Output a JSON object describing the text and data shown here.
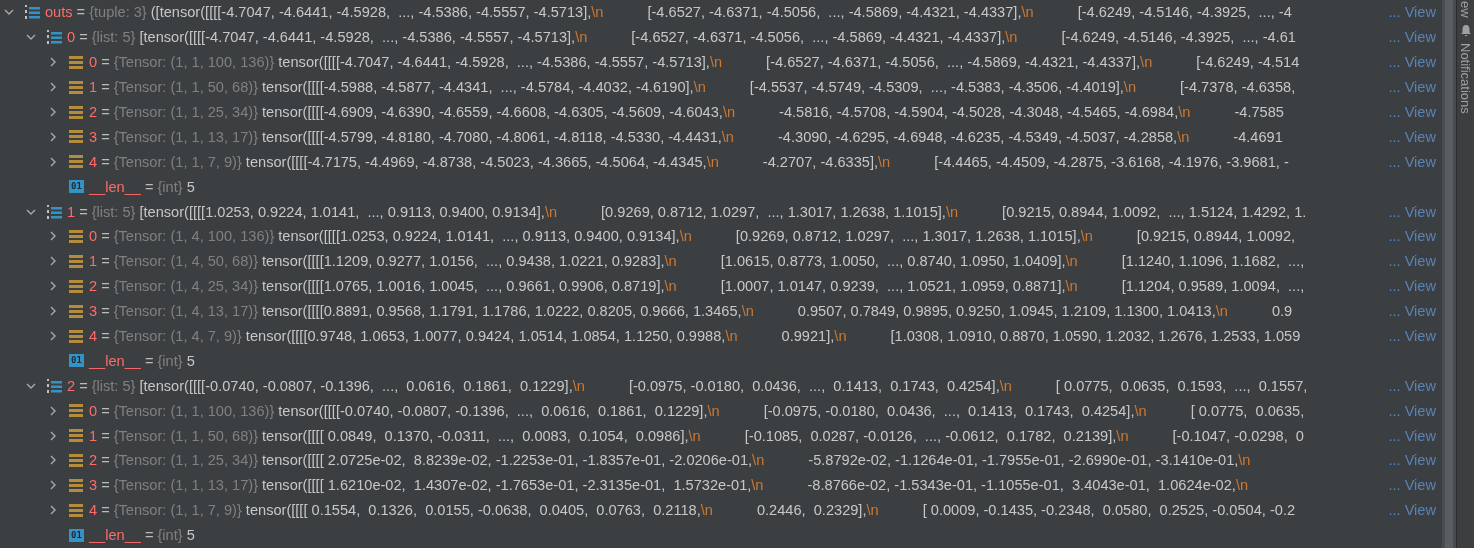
{
  "tree": [
    {
      "kind": "tuple",
      "name": "outs",
      "eq": "=",
      "type": "{tuple: 3}",
      "expanded": true,
      "parts": [
        {
          "kind": "text",
          "t": "([tensor([[[[-4.7047, -4.6441, -4.5928,  ..., -4.5386, -4.5557, -4.5713],"
        },
        {
          "kind": "nl",
          "t": "\\n"
        },
        {
          "kind": "text",
          "t": "[-4.6527, -4.6371, -4.5056,  ..., -4.5869, -4.4321, -4.4337],"
        },
        {
          "kind": "nl",
          "t": "\\n"
        },
        {
          "kind": "text",
          "t": "[-4.6249, -4.5146, -4.3925,  ..., -4"
        }
      ],
      "more": "...",
      "link": "View",
      "children": [
        {
          "kind": "list",
          "name": "0",
          "eq": "=",
          "type": "{list: 5}",
          "expanded": true,
          "parts": [
            {
              "kind": "text",
              "t": "[tensor([[[[-4.7047, -4.6441, -4.5928,  ..., -4.5386, -4.5557, -4.5713],"
            },
            {
              "kind": "nl",
              "t": "\\n"
            },
            {
              "kind": "text",
              "t": "[-4.6527, -4.6371, -4.5056,  ..., -4.5869, -4.4321, -4.4337],"
            },
            {
              "kind": "nl",
              "t": "\\n"
            },
            {
              "kind": "text",
              "t": "[-4.6249, -4.5146, -4.3925,  ..., -4.61"
            }
          ],
          "more": "...",
          "link": "View",
          "children": [
            {
              "kind": "tensor",
              "name": "0",
              "eq": "=",
              "type": "{Tensor: (1, 1, 100, 136)}",
              "expanded": false,
              "parts": [
                {
                  "kind": "text",
                  "t": "tensor([[[[-4.7047, -4.6441, -4.5928,  ..., -4.5386, -4.5557, -4.5713],"
                },
                {
                  "kind": "nl",
                  "t": "\\n"
                },
                {
                  "kind": "text",
                  "t": "[-4.6527, -4.6371, -4.5056,  ..., -4.5869, -4.4321, -4.4337],"
                },
                {
                  "kind": "nl",
                  "t": "\\n"
                },
                {
                  "kind": "text",
                  "t": "[-4.6249, -4.514"
                }
              ],
              "more": "...",
              "link": "View"
            },
            {
              "kind": "tensor",
              "name": "1",
              "eq": "=",
              "type": "{Tensor: (1, 1, 50, 68)}",
              "expanded": false,
              "parts": [
                {
                  "kind": "text",
                  "t": "tensor([[[[-4.5988, -4.5877, -4.4341,  ..., -4.5784, -4.4032, -4.6190],"
                },
                {
                  "kind": "nl",
                  "t": "\\n"
                },
                {
                  "kind": "text",
                  "t": "[-4.5537, -4.5749, -4.5309,  ..., -4.5383, -4.3506, -4.4019],"
                },
                {
                  "kind": "nl",
                  "t": "\\n"
                },
                {
                  "kind": "text",
                  "t": "[-4.7378, -4.6358,"
                }
              ],
              "more": "...",
              "link": "View"
            },
            {
              "kind": "tensor",
              "name": "2",
              "eq": "=",
              "type": "{Tensor: (1, 1, 25, 34)}",
              "expanded": false,
              "parts": [
                {
                  "kind": "text",
                  "t": "tensor([[[[-4.6909, -4.6390, -4.6559, -4.6608, -4.6305, -4.5609, -4.6043,"
                },
                {
                  "kind": "nl",
                  "t": "\\n"
                },
                {
                  "kind": "text",
                  "t": "-4.5816, -4.5708, -4.5904, -4.5028, -4.3048, -4.5465, -4.6984,"
                },
                {
                  "kind": "nl",
                  "t": "\\n"
                },
                {
                  "kind": "text",
                  "t": "-4.7585"
                }
              ],
              "more": "...",
              "link": "View"
            },
            {
              "kind": "tensor",
              "name": "3",
              "eq": "=",
              "type": "{Tensor: (1, 1, 13, 17)}",
              "expanded": false,
              "parts": [
                {
                  "kind": "text",
                  "t": "tensor([[[[-4.5799, -4.8180, -4.7080, -4.8061, -4.8118, -4.5330, -4.4431,"
                },
                {
                  "kind": "nl",
                  "t": "\\n"
                },
                {
                  "kind": "text",
                  "t": "-4.3090, -4.6295, -4.6948, -4.6235, -4.5349, -4.5037, -4.2858,"
                },
                {
                  "kind": "nl",
                  "t": "\\n"
                },
                {
                  "kind": "text",
                  "t": "-4.4691"
                }
              ],
              "more": "...",
              "link": "View"
            },
            {
              "kind": "tensor",
              "name": "4",
              "eq": "=",
              "type": "{Tensor: (1, 1, 7, 9)}",
              "expanded": false,
              "parts": [
                {
                  "kind": "text",
                  "t": "tensor([[[[-4.7175, -4.4969, -4.8738, -4.5023, -4.3665, -4.5064, -4.4345,"
                },
                {
                  "kind": "nl",
                  "t": "\\n"
                },
                {
                  "kind": "text",
                  "t": "-4.2707, -4.6335],"
                },
                {
                  "kind": "nl",
                  "t": "\\n"
                },
                {
                  "kind": "text",
                  "t": "[-4.4465, -4.4509, -4.2875, -3.6168, -4.1976, -3.9681, -"
                }
              ],
              "more": "...",
              "link": "View"
            },
            {
              "kind": "int",
              "badge": "01",
              "name": "__len__",
              "eq": "=",
              "type": "{int}",
              "parts": [
                {
                  "kind": "text",
                  "t": "5"
                }
              ]
            }
          ]
        },
        {
          "kind": "list",
          "name": "1",
          "eq": "=",
          "type": "{list: 5}",
          "expanded": true,
          "parts": [
            {
              "kind": "text",
              "t": "[tensor([[[[1.0253, 0.9224, 1.0141,  ..., 0.9113, 0.9400, 0.9134],"
            },
            {
              "kind": "nl",
              "t": "\\n"
            },
            {
              "kind": "text",
              "t": "[0.9269, 0.8712, 1.0297,  ..., 1.3017, 1.2638, 1.1015],"
            },
            {
              "kind": "nl",
              "t": "\\n"
            },
            {
              "kind": "text",
              "t": "[0.9215, 0.8944, 1.0092,  ..., 1.5124, 1.4292, 1."
            }
          ],
          "more": "...",
          "link": "View",
          "children": [
            {
              "kind": "tensor",
              "name": "0",
              "eq": "=",
              "type": "{Tensor: (1, 4, 100, 136)}",
              "expanded": false,
              "parts": [
                {
                  "kind": "text",
                  "t": "tensor([[[[1.0253, 0.9224, 1.0141,  ..., 0.9113, 0.9400, 0.9134],"
                },
                {
                  "kind": "nl",
                  "t": "\\n"
                },
                {
                  "kind": "text",
                  "t": "[0.9269, 0.8712, 1.0297,  ..., 1.3017, 1.2638, 1.1015],"
                },
                {
                  "kind": "nl",
                  "t": "\\n"
                },
                {
                  "kind": "text",
                  "t": "[0.9215, 0.8944, 1.0092,"
                }
              ],
              "more": "...",
              "link": "View"
            },
            {
              "kind": "tensor",
              "name": "1",
              "eq": "=",
              "type": "{Tensor: (1, 4, 50, 68)}",
              "expanded": false,
              "parts": [
                {
                  "kind": "text",
                  "t": "tensor([[[[1.1209, 0.9277, 1.0156,  ..., 0.9438, 1.0221, 0.9283],"
                },
                {
                  "kind": "nl",
                  "t": "\\n"
                },
                {
                  "kind": "text",
                  "t": "[1.0615, 0.8773, 1.0050,  ..., 0.8740, 1.0950, 1.0409],"
                },
                {
                  "kind": "nl",
                  "t": "\\n"
                },
                {
                  "kind": "text",
                  "t": "[1.1240, 1.1096, 1.1682,  ...,"
                }
              ],
              "more": "...",
              "link": "View"
            },
            {
              "kind": "tensor",
              "name": "2",
              "eq": "=",
              "type": "{Tensor: (1, 4, 25, 34)}",
              "expanded": false,
              "parts": [
                {
                  "kind": "text",
                  "t": "tensor([[[[1.0765, 1.0016, 1.0045,  ..., 0.9661, 0.9906, 0.8719],"
                },
                {
                  "kind": "nl",
                  "t": "\\n"
                },
                {
                  "kind": "text",
                  "t": "[1.0007, 1.0147, 0.9239,  ..., 1.0521, 1.0959, 0.8871],"
                },
                {
                  "kind": "nl",
                  "t": "\\n"
                },
                {
                  "kind": "text",
                  "t": "[1.1204, 0.9589, 1.0094,  ...,"
                }
              ],
              "more": "...",
              "link": "View"
            },
            {
              "kind": "tensor",
              "name": "3",
              "eq": "=",
              "type": "{Tensor: (1, 4, 13, 17)}",
              "expanded": false,
              "parts": [
                {
                  "kind": "text",
                  "t": "tensor([[[[0.8891, 0.9568, 1.1791, 1.1786, 1.0222, 0.8205, 0.9666, 1.3465,"
                },
                {
                  "kind": "nl",
                  "t": "\\n"
                },
                {
                  "kind": "text",
                  "t": "0.9507, 0.7849, 0.9895, 0.9250, 1.0945, 1.2109, 1.1300, 1.0413,"
                },
                {
                  "kind": "nl",
                  "t": "\\n"
                },
                {
                  "kind": "text",
                  "t": "0.9"
                }
              ],
              "more": "...",
              "link": "View"
            },
            {
              "kind": "tensor",
              "name": "4",
              "eq": "=",
              "type": "{Tensor: (1, 4, 7, 9)}",
              "expanded": false,
              "parts": [
                {
                  "kind": "text",
                  "t": "tensor([[[[0.9748, 1.0653, 1.0077, 0.9424, 1.0514, 1.0854, 1.1250, 0.9988,"
                },
                {
                  "kind": "nl",
                  "t": "\\n"
                },
                {
                  "kind": "text",
                  "t": "0.9921],"
                },
                {
                  "kind": "nl",
                  "t": "\\n"
                },
                {
                  "kind": "text",
                  "t": "[1.0308, 1.0910, 0.8870, 1.0590, 1.2032, 1.2676, 1.2533, 1.059"
                }
              ],
              "more": "...",
              "link": "View"
            },
            {
              "kind": "int",
              "badge": "01",
              "name": "__len__",
              "eq": "=",
              "type": "{int}",
              "parts": [
                {
                  "kind": "text",
                  "t": "5"
                }
              ]
            }
          ]
        },
        {
          "kind": "list",
          "name": "2",
          "eq": "=",
          "type": "{list: 5}",
          "expanded": true,
          "parts": [
            {
              "kind": "text",
              "t": "[tensor([[[[-0.0740, -0.0807, -0.1396,  ...,  0.0616,  0.1861,  0.1229],"
            },
            {
              "kind": "nl",
              "t": "\\n"
            },
            {
              "kind": "text",
              "t": "[-0.0975, -0.0180,  0.0436,  ...,  0.1413,  0.1743,  0.4254],"
            },
            {
              "kind": "nl",
              "t": "\\n"
            },
            {
              "kind": "text",
              "t": "[ 0.0775,  0.0635,  0.1593,  ...,  0.1557,"
            }
          ],
          "more": "...",
          "link": "View",
          "children": [
            {
              "kind": "tensor",
              "name": "0",
              "eq": "=",
              "type": "{Tensor: (1, 1, 100, 136)}",
              "expanded": false,
              "parts": [
                {
                  "kind": "text",
                  "t": "tensor([[[[-0.0740, -0.0807, -0.1396,  ...,  0.0616,  0.1861,  0.1229],"
                },
                {
                  "kind": "nl",
                  "t": "\\n"
                },
                {
                  "kind": "text",
                  "t": "[-0.0975, -0.0180,  0.0436,  ...,  0.1413,  0.1743,  0.4254],"
                },
                {
                  "kind": "nl",
                  "t": "\\n"
                },
                {
                  "kind": "text",
                  "t": "[ 0.0775,  0.0635,"
                }
              ],
              "more": "...",
              "link": "View"
            },
            {
              "kind": "tensor",
              "name": "1",
              "eq": "=",
              "type": "{Tensor: (1, 1, 50, 68)}",
              "expanded": false,
              "parts": [
                {
                  "kind": "text",
                  "t": "tensor([[[[ 0.0849,  0.1370, -0.0311,  ...,  0.0083,  0.1054,  0.0986],"
                },
                {
                  "kind": "nl",
                  "t": "\\n"
                },
                {
                  "kind": "text",
                  "t": "[-0.1085,  0.0287, -0.0126,  ..., -0.0612,  0.1782,  0.2139],"
                },
                {
                  "kind": "nl",
                  "t": "\\n"
                },
                {
                  "kind": "text",
                  "t": "[-0.1047, -0.0298,  0"
                }
              ],
              "more": "...",
              "link": "View"
            },
            {
              "kind": "tensor",
              "name": "2",
              "eq": "=",
              "type": "{Tensor: (1, 1, 25, 34)}",
              "expanded": false,
              "parts": [
                {
                  "kind": "text",
                  "t": "tensor([[[[ 2.0725e-02,  8.8239e-02, -1.2253e-01, -1.8357e-01, -2.0206e-01,"
                },
                {
                  "kind": "nl",
                  "t": "\\n"
                },
                {
                  "kind": "text",
                  "t": "-5.8792e-02, -1.1264e-01, -1.7955e-01, -2.6990e-01, -3.1410e-01,"
                },
                {
                  "kind": "nl",
                  "t": "\\n"
                }
              ],
              "more": "...",
              "link": "View"
            },
            {
              "kind": "tensor",
              "name": "3",
              "eq": "=",
              "type": "{Tensor: (1, 1, 13, 17)}",
              "expanded": false,
              "parts": [
                {
                  "kind": "text",
                  "t": "tensor([[[[ 1.6210e-02,  1.4307e-02, -1.7653e-01, -2.3135e-01,  1.5732e-01,"
                },
                {
                  "kind": "nl",
                  "t": "\\n"
                },
                {
                  "kind": "text",
                  "t": "-8.8766e-02, -1.5343e-01, -1.1055e-01,  3.4043e-01,  1.0624e-02,"
                },
                {
                  "kind": "nl",
                  "t": "\\n"
                }
              ],
              "more": "...",
              "link": "View"
            },
            {
              "kind": "tensor",
              "name": "4",
              "eq": "=",
              "type": "{Tensor: (1, 1, 7, 9)}",
              "expanded": false,
              "parts": [
                {
                  "kind": "text",
                  "t": "tensor([[[[ 0.1554,  0.1326,  0.0155, -0.0638,  0.0405,  0.0763,  0.2118,"
                },
                {
                  "kind": "nl",
                  "t": "\\n"
                },
                {
                  "kind": "text",
                  "t": "0.2446,  0.2329],"
                },
                {
                  "kind": "nl",
                  "t": "\\n"
                },
                {
                  "kind": "text",
                  "t": "[ 0.0009, -0.1435, -0.2348,  0.0580,  0.2525, -0.0504, -0.2"
                }
              ],
              "more": "...",
              "link": "View"
            },
            {
              "kind": "int",
              "badge": "01",
              "name": "__len__",
              "eq": "=",
              "type": "{int}",
              "parts": [
                {
                  "kind": "text",
                  "t": "5"
                }
              ]
            }
          ]
        }
      ]
    }
  ],
  "side_panel": {
    "labels": [
      "ew",
      "Notifications"
    ]
  }
}
